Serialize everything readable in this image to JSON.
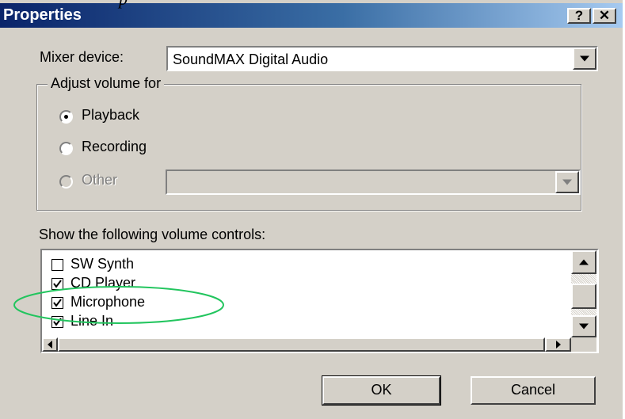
{
  "caption_fragment": "p",
  "window": {
    "title": "Properties",
    "help_btn": "?",
    "close_btn": "✕"
  },
  "mixer": {
    "label": "Mixer device:",
    "value": "SoundMAX Digital Audio"
  },
  "adjust": {
    "group_title": "Adjust volume for",
    "options": [
      {
        "label": "Playback",
        "selected": true,
        "enabled": true
      },
      {
        "label": "Recording",
        "selected": false,
        "enabled": true
      },
      {
        "label": "Other",
        "selected": false,
        "enabled": false
      }
    ]
  },
  "controls": {
    "label": "Show the following volume controls:",
    "items": [
      {
        "label": "SW Synth",
        "checked": false
      },
      {
        "label": "CD Player",
        "checked": true
      },
      {
        "label": "Microphone",
        "checked": true,
        "highlighted": true
      },
      {
        "label": "Line In",
        "checked": true
      }
    ]
  },
  "buttons": {
    "ok": "OK",
    "cancel": "Cancel"
  },
  "colors": {
    "dialog_bg": "#d4d0c8",
    "title_start": "#0a246a",
    "title_end": "#a6caf0",
    "highlight_ellipse": "#22c55e"
  }
}
